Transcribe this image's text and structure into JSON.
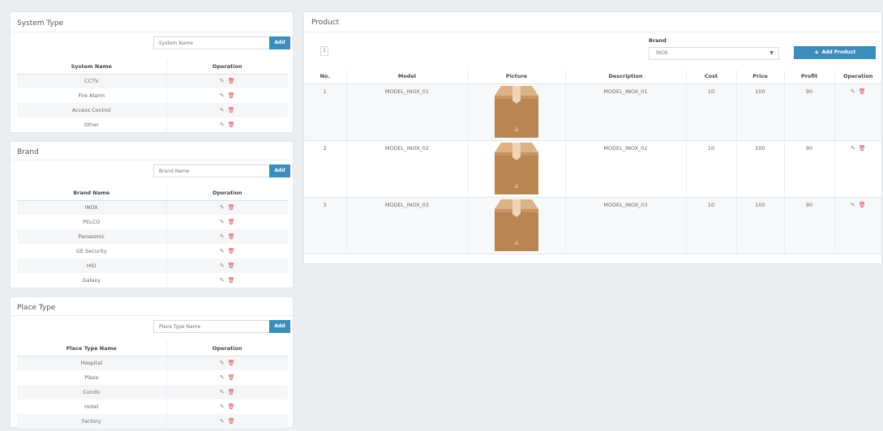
{
  "system_type": {
    "title": "System Type",
    "placeholder": "System Name",
    "add_label": "Add",
    "headers": [
      "System Name",
      "Operation"
    ],
    "rows": [
      "CCTV",
      "Fire Alarm",
      "Access Control",
      "Other"
    ]
  },
  "brand": {
    "title": "Brand",
    "placeholder": "Brand Name",
    "add_label": "Add",
    "headers": [
      "Brand Name",
      "Operation"
    ],
    "rows": [
      "INOX",
      "PELCO",
      "Panasonic",
      "GE Security",
      "HID",
      "Galaxy"
    ]
  },
  "place_type": {
    "title": "Place Type",
    "placeholder": "Place Type Name",
    "add_label": "Add",
    "headers": [
      "Place Type Name",
      "Operation"
    ],
    "rows": [
      "Hospital",
      "Plaza",
      "Condo",
      "Hotel",
      "Factory"
    ]
  },
  "product": {
    "title": "Product",
    "page": "1",
    "brand_label": "Brand",
    "brand_selected": "INOX",
    "add_product_label": "Add Product",
    "headers": [
      "No.",
      "Model",
      "Picture",
      "Description",
      "Cost",
      "Price",
      "Profit",
      "Operation"
    ],
    "rows": [
      {
        "no": "1",
        "model": "MODEL_INOX_01",
        "description": "MODEL_INOX_01",
        "cost": "10",
        "price": "100",
        "profit": "90"
      },
      {
        "no": "2",
        "model": "MODEL_INOX_02",
        "description": "MODEL_INOX_02",
        "cost": "10",
        "price": "100",
        "profit": "90"
      },
      {
        "no": "3",
        "model": "MODEL_INOX_03",
        "description": "MODEL_INOX_03",
        "cost": "10",
        "price": "100",
        "profit": "90"
      }
    ]
  },
  "colors": {
    "accent": "#3c8dbc",
    "delete": "#e05050",
    "box_light": "#d4a574",
    "box_dark": "#b07b4a"
  },
  "icons": {
    "edit": "edit-icon",
    "delete": "trash-icon",
    "dropdown": "caret-down-icon",
    "add": "plus-icon"
  }
}
